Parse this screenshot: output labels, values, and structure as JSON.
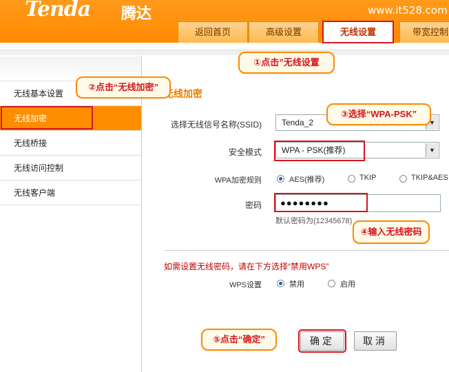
{
  "header": {
    "logo": "Tenda",
    "logo_cn": "腾达",
    "site_url": "www.it528.com",
    "tabs": [
      {
        "label": "返回首页"
      },
      {
        "label": "高级设置"
      },
      {
        "label": "无线设置"
      },
      {
        "label": "带宽控制"
      }
    ]
  },
  "sidebar": {
    "items": [
      {
        "label": "无线基本设置"
      },
      {
        "label": "无线加密"
      },
      {
        "label": "无线桥接"
      },
      {
        "label": "无线访问控制"
      },
      {
        "label": "无线客户端"
      }
    ]
  },
  "main": {
    "title": "无线加密",
    "ssid_label": "选择无线信号名称(SSID)",
    "ssid_value": "Tenda_2",
    "security_label": "安全模式",
    "security_value": "WPA - PSK(推荐)",
    "wpa_rule_label": "WPA加密规则",
    "wpa_options": [
      "AES(推荐)",
      "TKIP",
      "TKIP&AES"
    ],
    "password_label": "密码",
    "password_value": "●●●●●●●●",
    "default_password_note": "默认密码为(12345678)",
    "wps_note": "如需设置无线密码，请在下方选择“禁用WPS”",
    "wps_label": "WPS设置",
    "wps_options": [
      "禁用",
      "启用"
    ],
    "confirm": "确定",
    "cancel": "取消"
  },
  "callouts": {
    "c1": "①点击”无线设置",
    "c2": "②点击“无线加密”",
    "c3": "③选择“WPA-PSK”",
    "c4": "④输入无线密码",
    "c5": "⑤点击“确定”"
  },
  "colors": {
    "header_orange": "#ff8a00",
    "highlight_red": "#d8141d",
    "title_orange": "#ee7d00"
  }
}
